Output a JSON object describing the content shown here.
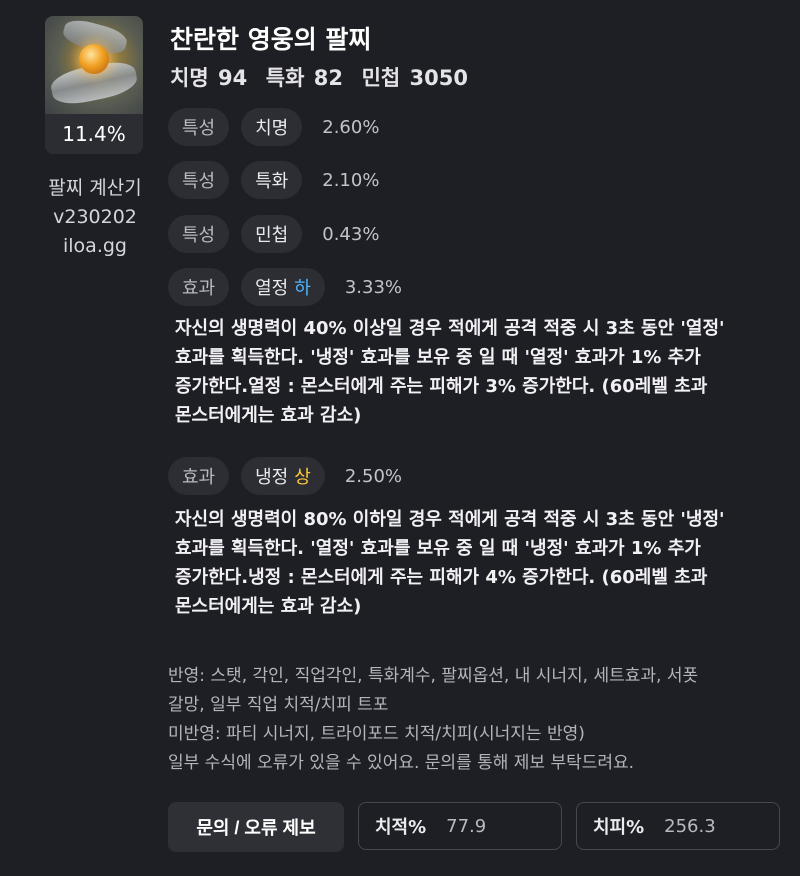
{
  "item": {
    "icon": "bracelet-icon",
    "percent": "11.4%",
    "name": "찬란한 영웅의 팔찌",
    "stats": "치명 94  특화 82  민첩 3050"
  },
  "calculator": {
    "name": "팔찌 계산기",
    "version": "v230202",
    "site": "iloa.gg"
  },
  "rows": [
    {
      "tag": "특성",
      "name": "치명",
      "value": "2.60%"
    },
    {
      "tag": "특성",
      "name": "특화",
      "value": "2.10%"
    },
    {
      "tag": "특성",
      "name": "민첩",
      "value": "0.43%"
    }
  ],
  "effects": [
    {
      "tag": "효과",
      "name": "열정",
      "grade": "하",
      "value": "3.33%",
      "lines": [
        "자신의 생명력이 40% 이상일 경우 적에게 공격 적중 시 3초 동안 '열정'",
        "효과를 획득한다. '냉정' 효과를 보유 중 일 때 '열정' 효과가 1% 추가",
        "증가한다.열정 : 몬스터에게 주는 피해가 3% 증가한다. (60레벨 초과",
        "몬스터에게는 효과 감소)"
      ]
    },
    {
      "tag": "효과",
      "name": "냉정",
      "grade": "상",
      "value": "2.50%",
      "lines": [
        "자신의 생명력이 80% 이하일 경우 적에게 공격 적중 시 3초 동안 '냉정'",
        "효과를 획득한다. '열정' 효과를 보유 중 일 때 '냉정' 효과가 1% 추가",
        "증가한다.냉정 : 몬스터에게 주는 피해가 4% 증가한다. (60레벨 초과",
        "몬스터에게는 효과 감소)"
      ]
    }
  ],
  "notes": {
    "reflected": "반영: 스탯, 각인, 직업각인, 특화계수, 팔찌옵션, 내 시너지, 세트효과, 서폿",
    "reflected_2": "갈망, 일부 직업 치적/치피 트포",
    "not_reflected": "미반영: 파티 시너지, 트라이포드 치적/치피(시너지는 반영)",
    "errors": "일부 수식에 오류가 있을 수 있어요. 문의를 통해 제보 부탁드려요."
  },
  "footer": {
    "report_button": "문의 / 오류 제보",
    "crit_rate_label": "치적%",
    "crit_rate_value": "77.9",
    "crit_dmg_label": "치피%",
    "crit_dmg_value": "256.3"
  },
  "colors": {
    "background": "#1e1f24",
    "grade_low": "#4fb2ff",
    "grade_high": "#ffc83a"
  }
}
